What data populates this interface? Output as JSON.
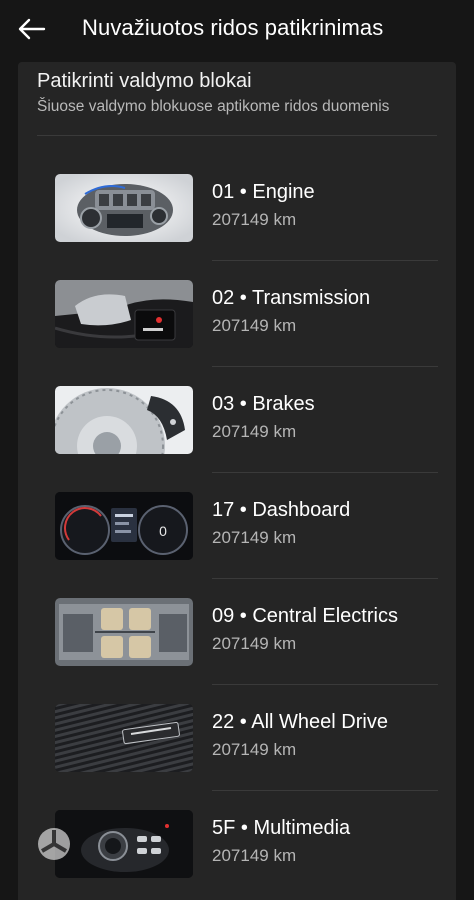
{
  "header": {
    "title": "Nuvažiuotos ridos patikrinimas",
    "back_icon": "arrow-left-icon"
  },
  "card": {
    "title": "Patikrinti valdymo blokai",
    "subtitle": "Šiuose valdymo blokuose aptikome ridos duomenis"
  },
  "modules": [
    {
      "name": "01 • Engine",
      "km": "207149 km",
      "image": "engine"
    },
    {
      "name": "02 • Transmission",
      "km": "207149 km",
      "image": "gear-shifter"
    },
    {
      "name": "03 • Brakes",
      "km": "207149 km",
      "image": "brake-disc"
    },
    {
      "name": "17 • Dashboard",
      "km": "207149 km",
      "image": "instrument-cluster"
    },
    {
      "name": "09 • Central Electrics",
      "km": "207149 km",
      "image": "chassis-electrics"
    },
    {
      "name": "22 • All Wheel Drive",
      "km": "207149 km",
      "image": "quattro-badge"
    },
    {
      "name": "5F • Multimedia",
      "km": "207149 km",
      "image": "mmi-controller"
    }
  ],
  "colors": {
    "background": "#161616",
    "card": "#252525",
    "divider": "#3a3a3a",
    "subtext": "#b5b5b5"
  }
}
